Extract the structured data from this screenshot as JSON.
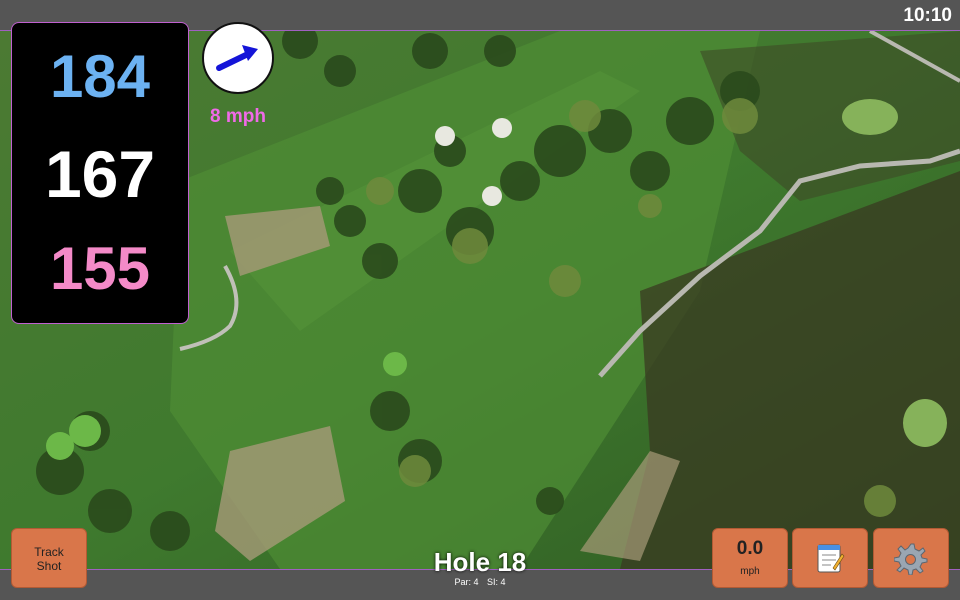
{
  "status_bar": {
    "clock": "10:10"
  },
  "distances": {
    "back": "184",
    "middle": "167",
    "front": "155",
    "colors": {
      "back": "#6cb2f2",
      "middle": "#ffffff",
      "front": "#f48ac8"
    }
  },
  "wind": {
    "speed": "8 mph",
    "direction_icon": "arrow-icon",
    "colors": {
      "arrow": "#1414d8",
      "text": "#f06ae8"
    }
  },
  "buttons": {
    "track_shot": [
      "Track",
      "Shot"
    ],
    "speed_value": "0.0",
    "speed_unit": "mph",
    "notes_icon": "notepad-icon",
    "settings_icon": "gear-icon"
  },
  "hole": {
    "title": "Hole 18",
    "par": "Par: 4",
    "si": "SI: 4"
  },
  "colors": {
    "button": "#d9764a",
    "bar": "#555555",
    "border": "#c060d0"
  }
}
